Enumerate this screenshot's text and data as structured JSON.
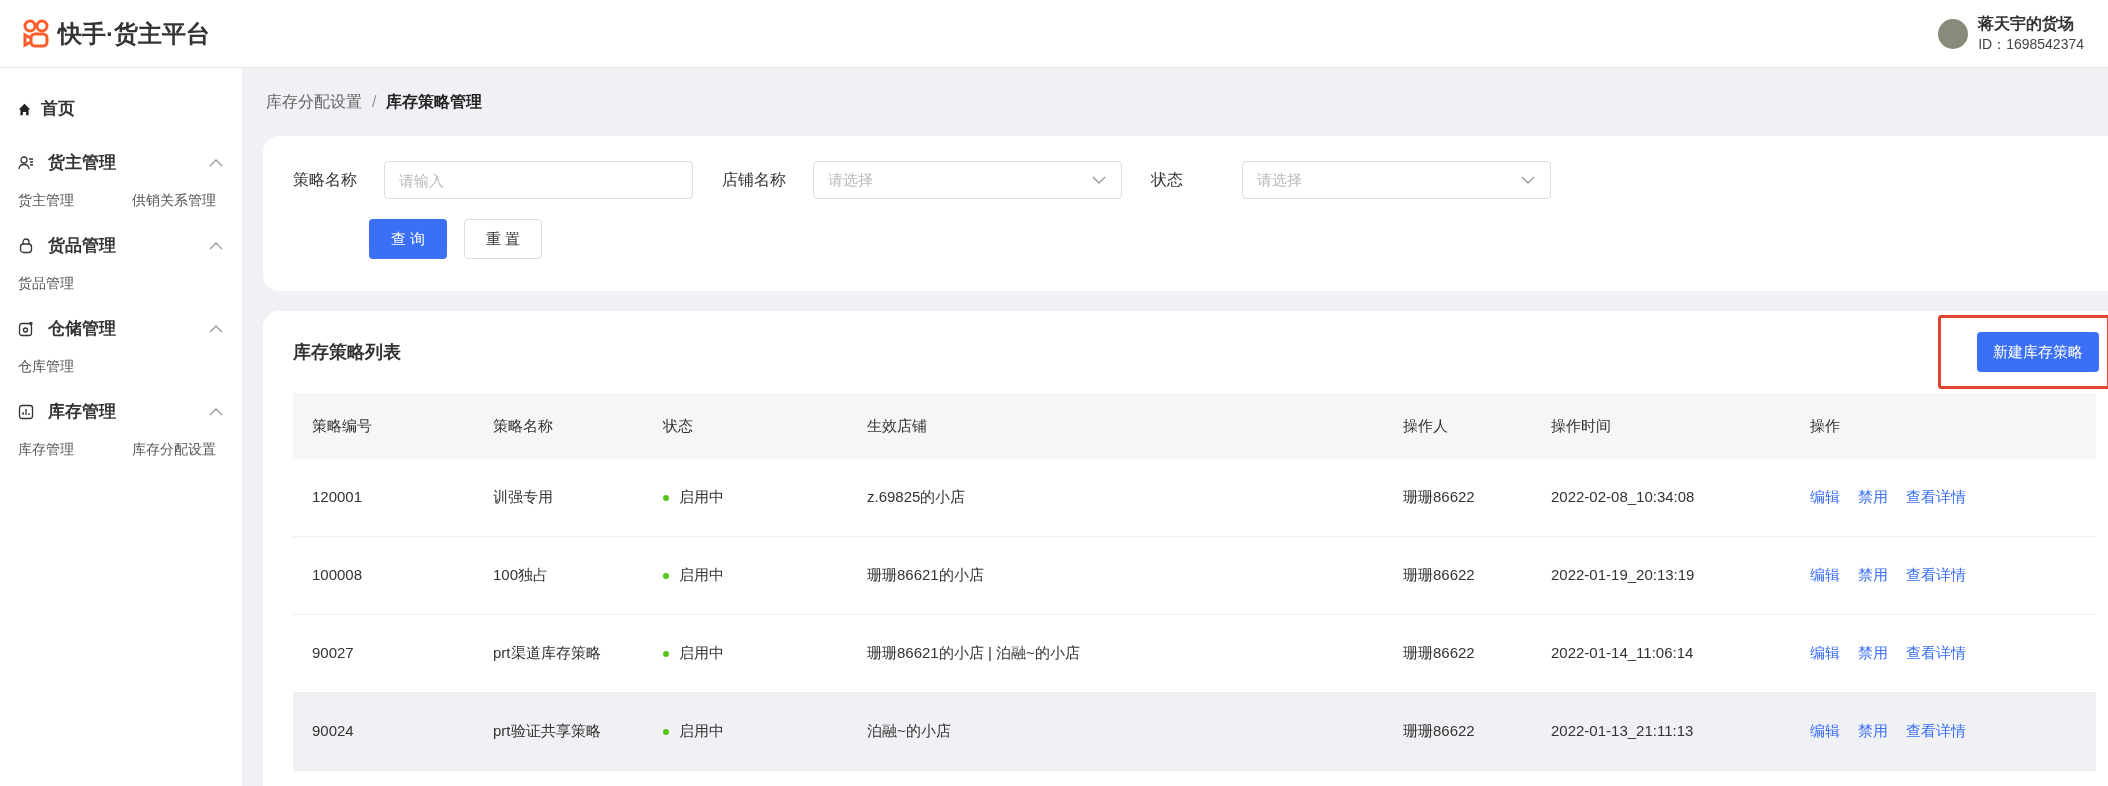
{
  "header": {
    "brand": "快手·货主平台",
    "user": {
      "name": "蒋天宇的货场",
      "id": "ID：1698542374"
    }
  },
  "sidebar": {
    "home": "首页",
    "groups": [
      {
        "kind": "users",
        "title": "货主管理",
        "expanded": true,
        "items": [
          "货主管理",
          "供销关系管理"
        ]
      },
      {
        "kind": "bag",
        "title": "货品管理",
        "expanded": true,
        "items": [
          "货品管理"
        ]
      },
      {
        "kind": "warehouse",
        "title": "仓储管理",
        "expanded": true,
        "items": [
          "仓库管理"
        ]
      },
      {
        "kind": "chart",
        "title": "库存管理",
        "expanded": true,
        "items": [
          "库存管理",
          "库存分配设置"
        ]
      }
    ]
  },
  "breadcrumb": [
    "库存分配设置",
    "库存策略管理"
  ],
  "breadcrumb_separator": "/",
  "filters": [
    {
      "kind": "input",
      "label": "策略名称",
      "placeholder": "请输入"
    },
    {
      "kind": "select",
      "label": "店铺名称",
      "placeholder": "请选择"
    },
    {
      "kind": "select",
      "label": "状态",
      "placeholder": "请选择"
    }
  ],
  "filter_buttons": [
    {
      "label": "查 询",
      "primary": true
    },
    {
      "label": "重 置",
      "primary": false
    }
  ],
  "list": {
    "title": "库存策略列表",
    "new_button": "新建库存策略",
    "new_button_highlighted": true,
    "columns": [
      "策略编号",
      "策略名称",
      "状态",
      "生效店铺",
      "操作人",
      "操作时间",
      "操作"
    ],
    "rows": [
      {
        "id": "120001",
        "name": "训强专用",
        "status": "启用中",
        "color": "#52c41a",
        "shops": "z.69825的小店",
        "operator": "珊珊86622",
        "time": "2022-02-08_10:34:08",
        "actions": [
          "编辑",
          "禁用",
          "查看详情"
        ],
        "hovered": false
      },
      {
        "id": "100008",
        "name": "100独占",
        "status": "启用中",
        "color": "#52c41a",
        "shops": "珊珊86621的小店",
        "operator": "珊珊86622",
        "time": "2022-01-19_20:13:19",
        "actions": [
          "编辑",
          "禁用",
          "查看详情"
        ],
        "hovered": false
      },
      {
        "id": "90027",
        "name": "prt渠道库存策略",
        "status": "启用中",
        "color": "#52c41a",
        "shops": "珊珊86621的小店 | 泊融~的小店",
        "operator": "珊珊86622",
        "time": "2022-01-14_11:06:14",
        "actions": [
          "编辑",
          "禁用",
          "查看详情"
        ],
        "hovered": false
      },
      {
        "id": "90024",
        "name": "prt验证共享策略",
        "status": "启用中",
        "color": "#52c41a",
        "shops": "泊融~的小店",
        "operator": "珊珊86622",
        "time": "2022-01-13_21:11:13",
        "actions": [
          "编辑",
          "禁用",
          "查看详情"
        ],
        "hovered": true
      }
    ]
  }
}
